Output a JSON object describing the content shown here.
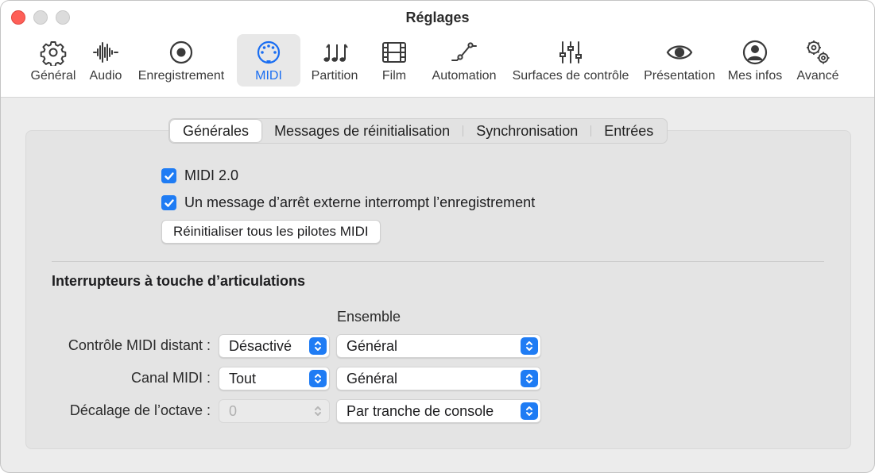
{
  "window": {
    "title": "Réglages"
  },
  "colors": {
    "accent": "#1f7cf4",
    "close": "#fe5f57"
  },
  "toolbar": {
    "items": [
      {
        "label": "Général",
        "icon": "gear-icon",
        "active": false
      },
      {
        "label": "Audio",
        "icon": "waveform-icon",
        "active": false
      },
      {
        "label": "Enregistrement",
        "icon": "record-icon",
        "active": false
      },
      {
        "label": "MIDI",
        "icon": "midi-connector-icon",
        "active": true
      },
      {
        "label": "Partition",
        "icon": "music-notes-icon",
        "active": false
      },
      {
        "label": "Film",
        "icon": "film-icon",
        "active": false
      },
      {
        "label": "Automation",
        "icon": "automation-curve-icon",
        "active": false
      },
      {
        "label": "Surfaces de contrôle",
        "icon": "faders-icon",
        "active": false
      },
      {
        "label": "Présentation",
        "icon": "eye-icon",
        "active": false
      },
      {
        "label": "Mes infos",
        "icon": "person-icon",
        "active": false
      },
      {
        "label": "Avancé",
        "icon": "gears-icon",
        "active": false
      }
    ]
  },
  "tabs": [
    {
      "label": "Générales",
      "active": true
    },
    {
      "label": "Messages de réinitialisation",
      "active": false
    },
    {
      "label": "Synchronisation",
      "active": false
    },
    {
      "label": "Entrées",
      "active": false
    }
  ],
  "general": {
    "midi2_label": "MIDI 2.0",
    "midi2_checked": true,
    "stop_label": "Un message d’arrêt externe interrompt l’enregistrement",
    "stop_checked": true,
    "reset_button": "Réinitialiser tous les pilotes MIDI"
  },
  "articulation": {
    "title": "Interrupteurs à touche d’articulations",
    "column_header": "Ensemble",
    "rows": [
      {
        "label": "Contrôle MIDI distant :",
        "value": "Désactivé",
        "ensemble": "Général",
        "disabled": false
      },
      {
        "label": "Canal MIDI :",
        "value": "Tout",
        "ensemble": "Général",
        "disabled": false
      },
      {
        "label": "Décalage de l’octave :",
        "value": "0",
        "ensemble": "Par tranche de console",
        "disabled": true
      }
    ]
  }
}
